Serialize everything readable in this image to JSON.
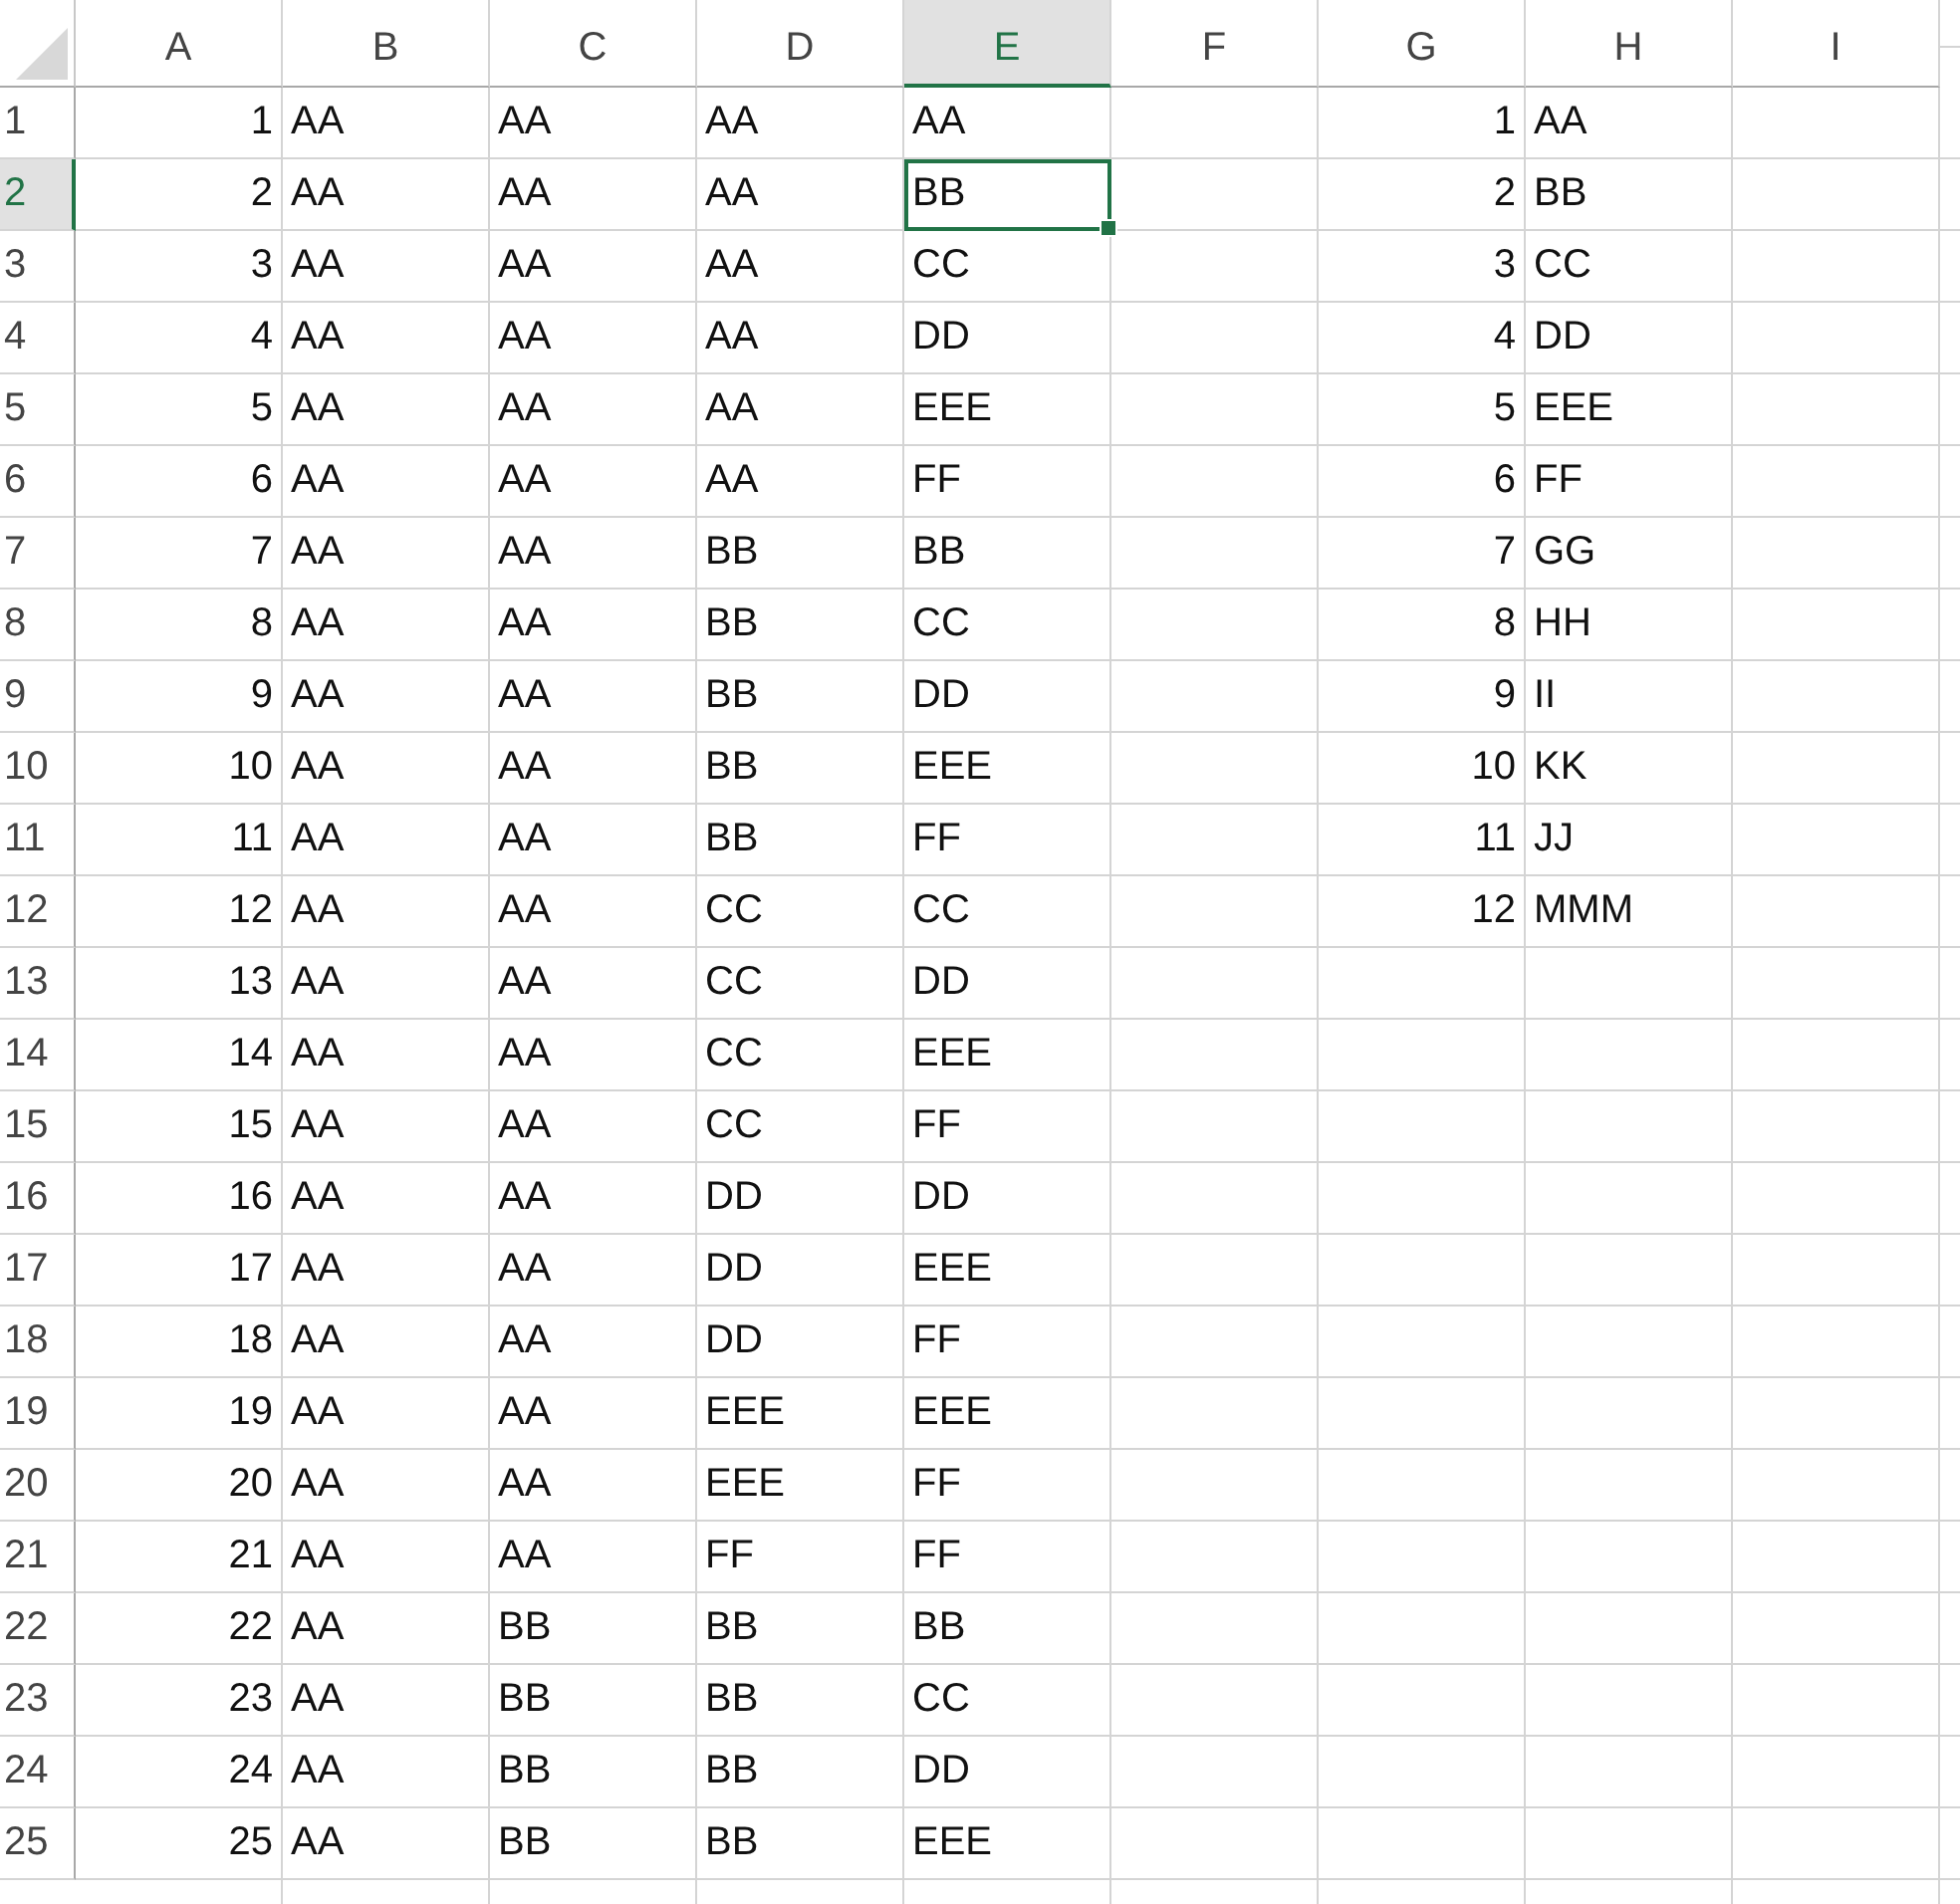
{
  "columns": [
    {
      "label": "A",
      "selected": false
    },
    {
      "label": "B",
      "selected": false
    },
    {
      "label": "C",
      "selected": false
    },
    {
      "label": "D",
      "selected": false
    },
    {
      "label": "E",
      "selected": true
    },
    {
      "label": "F",
      "selected": false
    },
    {
      "label": "G",
      "selected": false
    },
    {
      "label": "H",
      "selected": false
    },
    {
      "label": "I",
      "selected": false
    }
  ],
  "rows": [
    {
      "header": "1",
      "selected": false,
      "cells": [
        "1",
        "AA",
        "AA",
        "AA",
        "AA"
      ],
      "lookup": [
        "1",
        "AA"
      ]
    },
    {
      "header": "2",
      "selected": true,
      "cells": [
        "2",
        "AA",
        "AA",
        "AA",
        "BB"
      ],
      "lookup": [
        "2",
        "BB"
      ]
    },
    {
      "header": "3",
      "selected": false,
      "cells": [
        "3",
        "AA",
        "AA",
        "AA",
        "CC"
      ],
      "lookup": [
        "3",
        "CC"
      ]
    },
    {
      "header": "4",
      "selected": false,
      "cells": [
        "4",
        "AA",
        "AA",
        "AA",
        "DD"
      ],
      "lookup": [
        "4",
        "DD"
      ]
    },
    {
      "header": "5",
      "selected": false,
      "cells": [
        "5",
        "AA",
        "AA",
        "AA",
        "EEE"
      ],
      "lookup": [
        "5",
        "EEE"
      ]
    },
    {
      "header": "6",
      "selected": false,
      "cells": [
        "6",
        "AA",
        "AA",
        "AA",
        "FF"
      ],
      "lookup": [
        "6",
        "FF"
      ]
    },
    {
      "header": "7",
      "selected": false,
      "cells": [
        "7",
        "AA",
        "AA",
        "BB",
        "BB"
      ],
      "lookup": [
        "7",
        "GG"
      ]
    },
    {
      "header": "8",
      "selected": false,
      "cells": [
        "8",
        "AA",
        "AA",
        "BB",
        "CC"
      ],
      "lookup": [
        "8",
        "HH"
      ]
    },
    {
      "header": "9",
      "selected": false,
      "cells": [
        "9",
        "AA",
        "AA",
        "BB",
        "DD"
      ],
      "lookup": [
        "9",
        "II"
      ]
    },
    {
      "header": "10",
      "selected": false,
      "cells": [
        "10",
        "AA",
        "AA",
        "BB",
        "EEE"
      ],
      "lookup": [
        "10",
        "KK"
      ]
    },
    {
      "header": "11",
      "selected": false,
      "cells": [
        "11",
        "AA",
        "AA",
        "BB",
        "FF"
      ],
      "lookup": [
        "11",
        "JJ"
      ]
    },
    {
      "header": "12",
      "selected": false,
      "cells": [
        "12",
        "AA",
        "AA",
        "CC",
        "CC"
      ],
      "lookup": [
        "12",
        "MMM"
      ]
    },
    {
      "header": "13",
      "selected": false,
      "cells": [
        "13",
        "AA",
        "AA",
        "CC",
        "DD"
      ]
    },
    {
      "header": "14",
      "selected": false,
      "cells": [
        "14",
        "AA",
        "AA",
        "CC",
        "EEE"
      ]
    },
    {
      "header": "15",
      "selected": false,
      "cells": [
        "15",
        "AA",
        "AA",
        "CC",
        "FF"
      ]
    },
    {
      "header": "16",
      "selected": false,
      "cells": [
        "16",
        "AA",
        "AA",
        "DD",
        "DD"
      ]
    },
    {
      "header": "17",
      "selected": false,
      "cells": [
        "17",
        "AA",
        "AA",
        "DD",
        "EEE"
      ]
    },
    {
      "header": "18",
      "selected": false,
      "cells": [
        "18",
        "AA",
        "AA",
        "DD",
        "FF"
      ]
    },
    {
      "header": "19",
      "selected": false,
      "cells": [
        "19",
        "AA",
        "AA",
        "EEE",
        "EEE"
      ]
    },
    {
      "header": "20",
      "selected": false,
      "cells": [
        "20",
        "AA",
        "AA",
        "EEE",
        "FF"
      ]
    },
    {
      "header": "21",
      "selected": false,
      "cells": [
        "21",
        "AA",
        "AA",
        "FF",
        "FF"
      ]
    },
    {
      "header": "22",
      "selected": false,
      "cells": [
        "22",
        "AA",
        "BB",
        "BB",
        "BB"
      ]
    },
    {
      "header": "23",
      "selected": false,
      "cells": [
        "23",
        "AA",
        "BB",
        "BB",
        "CC"
      ]
    },
    {
      "header": "24",
      "selected": false,
      "cells": [
        "24",
        "AA",
        "BB",
        "BB",
        "DD"
      ]
    },
    {
      "header": "25",
      "selected": false,
      "cells": [
        "25",
        "AA",
        "BB",
        "BB",
        "EEE"
      ]
    }
  ]
}
